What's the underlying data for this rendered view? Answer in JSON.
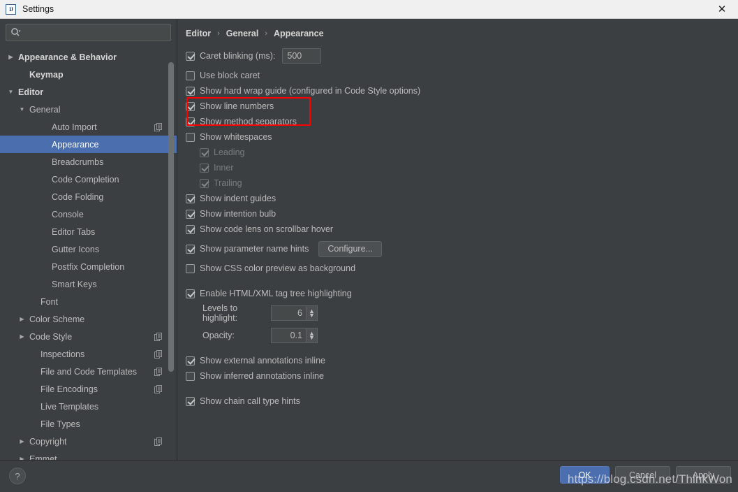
{
  "window": {
    "title": "Settings",
    "app_icon": "intellij-idea-icon",
    "close_label": "✕"
  },
  "sidebar": {
    "search": {
      "value": "",
      "placeholder": "",
      "icon": "search-icon"
    },
    "items": [
      {
        "label": "Appearance & Behavior",
        "arrow": "▶",
        "level": 0,
        "bold": true,
        "selected": false,
        "copy": false
      },
      {
        "label": "Keymap",
        "arrow": "",
        "level": 1,
        "bold": true,
        "selected": false,
        "copy": false
      },
      {
        "label": "Editor",
        "arrow": "▼",
        "level": 0,
        "bold": true,
        "selected": false,
        "copy": false
      },
      {
        "label": "General",
        "arrow": "▼",
        "level": 1,
        "bold": false,
        "selected": false,
        "copy": false
      },
      {
        "label": "Auto Import",
        "arrow": "",
        "level": 3,
        "bold": false,
        "selected": false,
        "copy": true
      },
      {
        "label": "Appearance",
        "arrow": "",
        "level": 3,
        "bold": false,
        "selected": true,
        "copy": false
      },
      {
        "label": "Breadcrumbs",
        "arrow": "",
        "level": 3,
        "bold": false,
        "selected": false,
        "copy": false
      },
      {
        "label": "Code Completion",
        "arrow": "",
        "level": 3,
        "bold": false,
        "selected": false,
        "copy": false
      },
      {
        "label": "Code Folding",
        "arrow": "",
        "level": 3,
        "bold": false,
        "selected": false,
        "copy": false
      },
      {
        "label": "Console",
        "arrow": "",
        "level": 3,
        "bold": false,
        "selected": false,
        "copy": false
      },
      {
        "label": "Editor Tabs",
        "arrow": "",
        "level": 3,
        "bold": false,
        "selected": false,
        "copy": false
      },
      {
        "label": "Gutter Icons",
        "arrow": "",
        "level": 3,
        "bold": false,
        "selected": false,
        "copy": false
      },
      {
        "label": "Postfix Completion",
        "arrow": "",
        "level": 3,
        "bold": false,
        "selected": false,
        "copy": false
      },
      {
        "label": "Smart Keys",
        "arrow": "",
        "level": 3,
        "bold": false,
        "selected": false,
        "copy": false
      },
      {
        "label": "Font",
        "arrow": "",
        "level": 2,
        "bold": false,
        "selected": false,
        "copy": false
      },
      {
        "label": "Color Scheme",
        "arrow": "▶",
        "level": 1,
        "bold": false,
        "selected": false,
        "copy": false
      },
      {
        "label": "Code Style",
        "arrow": "▶",
        "level": 1,
        "bold": false,
        "selected": false,
        "copy": true
      },
      {
        "label": "Inspections",
        "arrow": "",
        "level": 2,
        "bold": false,
        "selected": false,
        "copy": true
      },
      {
        "label": "File and Code Templates",
        "arrow": "",
        "level": 2,
        "bold": false,
        "selected": false,
        "copy": true
      },
      {
        "label": "File Encodings",
        "arrow": "",
        "level": 2,
        "bold": false,
        "selected": false,
        "copy": true
      },
      {
        "label": "Live Templates",
        "arrow": "",
        "level": 2,
        "bold": false,
        "selected": false,
        "copy": false
      },
      {
        "label": "File Types",
        "arrow": "",
        "level": 2,
        "bold": false,
        "selected": false,
        "copy": false
      },
      {
        "label": "Copyright",
        "arrow": "▶",
        "level": 1,
        "bold": false,
        "selected": false,
        "copy": true
      },
      {
        "label": "Emmet",
        "arrow": "▶",
        "level": 1,
        "bold": false,
        "selected": false,
        "copy": false
      }
    ]
  },
  "breadcrumb": {
    "parts": [
      "Editor",
      "General",
      "Appearance"
    ],
    "separator": "›"
  },
  "options": {
    "caret_blinking": {
      "label": "Caret blinking (ms):",
      "checked": true,
      "value": "500"
    },
    "use_block_caret": {
      "label": "Use block caret",
      "checked": false
    },
    "show_hard_wrap": {
      "label": "Show hard wrap guide (configured in Code Style options)",
      "checked": true
    },
    "show_line_numbers": {
      "label": "Show line numbers",
      "checked": true
    },
    "show_method_separators": {
      "label": "Show method separators",
      "checked": true
    },
    "show_whitespaces": {
      "label": "Show whitespaces",
      "checked": false
    },
    "ws_leading": {
      "label": "Leading",
      "checked": true,
      "disabled": true
    },
    "ws_inner": {
      "label": "Inner",
      "checked": true,
      "disabled": true
    },
    "ws_trailing": {
      "label": "Trailing",
      "checked": true,
      "disabled": true
    },
    "show_indent_guides": {
      "label": "Show indent guides",
      "checked": true
    },
    "show_intention_bulb": {
      "label": "Show intention bulb",
      "checked": true
    },
    "show_code_lens": {
      "label": "Show code lens on scrollbar hover",
      "checked": true
    },
    "show_param_hints": {
      "label": "Show parameter name hints",
      "checked": true,
      "button": "Configure..."
    },
    "show_css_preview": {
      "label": "Show CSS color preview as background",
      "checked": false
    },
    "enable_tag_tree": {
      "label": "Enable HTML/XML tag tree highlighting",
      "checked": true
    },
    "levels_to_highlight": {
      "label": "Levels to highlight:",
      "value": "6"
    },
    "opacity": {
      "label": "Opacity:",
      "value": "0.1"
    },
    "show_external_annotations": {
      "label": "Show external annotations inline",
      "checked": true
    },
    "show_inferred_annotations": {
      "label": "Show inferred annotations inline",
      "checked": false
    },
    "show_chain_call_hints": {
      "label": "Show chain call type hints",
      "checked": true
    }
  },
  "annotation": {
    "color": "#ff0000"
  },
  "footer": {
    "help_label": "?",
    "ok_label": "OK",
    "cancel_label": "Cancel",
    "apply_label": "Apply"
  },
  "watermark": {
    "text": "https://blog.csdn.net/ThinkWon"
  }
}
